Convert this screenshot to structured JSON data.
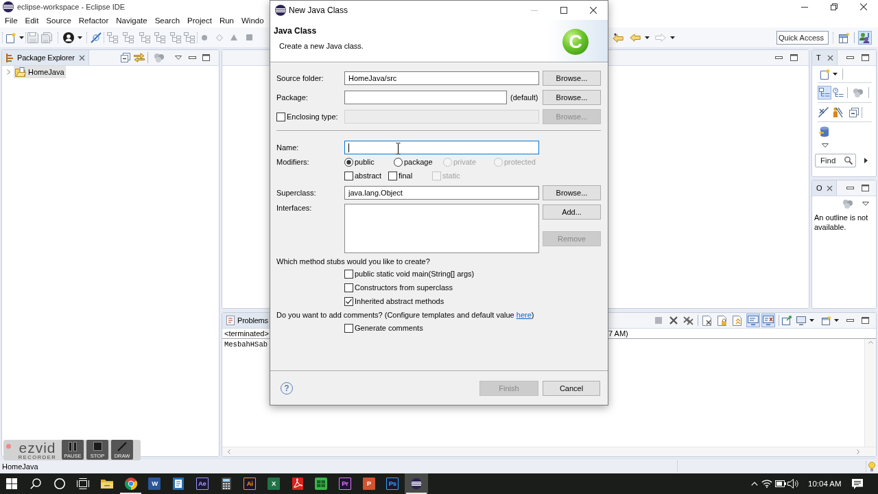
{
  "window": {
    "title": "eclipse-workspace - Eclipse IDE"
  },
  "menu": [
    "File",
    "Edit",
    "Source",
    "Refactor",
    "Navigate",
    "Search",
    "Project",
    "Run",
    "Windo"
  ],
  "toolbar": {
    "quick_access": {
      "placeholder": "Quick Access"
    },
    "perspective_button": {
      "selected": true
    }
  },
  "package_explorer": {
    "tab": "Package Explorer",
    "tree": [
      {
        "label": "HomeJava",
        "selected": true,
        "expanded": false
      }
    ]
  },
  "task_list": {
    "tab": "T",
    "toggles": [
      {
        "selected": true
      },
      {
        "selected": false
      }
    ],
    "find": {
      "placeholder": "Find"
    }
  },
  "outline": {
    "tab": "O",
    "message": "An outline is not available."
  },
  "console": {
    "tab": "Problems",
    "toolbar_toggles": [
      {
        "selected": true
      },
      {
        "selected": true
      }
    ],
    "launch_line": [
      "<terminated>",
      "7 AM)"
    ],
    "output": [
      "MesbahHSab"
    ]
  },
  "status_bar": {
    "text": "HomeJava"
  },
  "recorder": {
    "logo": "ezvid",
    "subtitle": "RECORDER",
    "buttons": [
      {
        "kind": "pause",
        "label": "PAUSE"
      },
      {
        "kind": "stop",
        "label": "STOP"
      },
      {
        "kind": "draw",
        "label": "DRAW"
      }
    ]
  },
  "dialog": {
    "title": "New Java Class",
    "window_buttons": [
      {
        "kind": "minimize",
        "disabled": true
      },
      {
        "kind": "maximize",
        "disabled": false
      },
      {
        "kind": "close",
        "disabled": false
      }
    ],
    "heading": "Java Class",
    "description": "Create a new Java class.",
    "badge": "C",
    "rows": [
      {
        "kind": "text",
        "label": "Source folder:",
        "value": "HomeJava/src",
        "disabled": false,
        "button": {
          "label": "Browse...",
          "disabled": false
        }
      },
      {
        "kind": "text",
        "label": "Package:",
        "suffix": "(default)",
        "disabled": false,
        "button": {
          "label": "Browse...",
          "disabled": false
        }
      },
      {
        "kind": "check",
        "label": "Enclosing type:",
        "checked": false,
        "disabled": true,
        "button": {
          "label": "Browse...",
          "disabled": true
        }
      }
    ],
    "name": {
      "label": "Name:",
      "focused": true
    },
    "modifiers": {
      "label": "Modifiers:",
      "access": [
        {
          "label": "public",
          "selected": true,
          "disabled": false
        },
        {
          "label": "package",
          "selected": false,
          "disabled": false
        },
        {
          "label": "private",
          "selected": false,
          "disabled": true
        },
        {
          "label": "protected",
          "selected": false,
          "disabled": true
        }
      ],
      "flags": [
        {
          "label": "abstract",
          "checked": false,
          "disabled": false
        },
        {
          "label": "final",
          "checked": false,
          "disabled": false
        },
        {
          "label": "static",
          "checked": false,
          "disabled": true
        }
      ]
    },
    "superclass": {
      "label": "Superclass:",
      "value": "java.lang.Object",
      "button": {
        "label": "Browse...",
        "disabled": false
      }
    },
    "interfaces": {
      "label": "Interfaces:",
      "buttons": [
        {
          "label": "Add...",
          "disabled": false
        },
        {
          "label": "Remove",
          "disabled": true
        }
      ]
    },
    "stubs": {
      "question": "Which method stubs would you like to create?",
      "options": [
        {
          "label": "public static void main(String[] args)",
          "checked": false
        },
        {
          "label": "Constructors from superclass",
          "checked": false
        },
        {
          "label": "Inherited abstract methods",
          "checked": true
        }
      ]
    },
    "comments": {
      "question": "Do you want to add comments? (Configure templates and default value",
      "link": "here",
      "closing": ")",
      "options": [
        {
          "label": "Generate comments",
          "checked": false
        }
      ]
    },
    "help": "?",
    "buttons": [
      {
        "label": "Finish",
        "disabled": true
      },
      {
        "label": "Cancel",
        "disabled": false
      }
    ]
  },
  "taskbar": {
    "apps": [
      {
        "kind": "folder",
        "running": false,
        "selected": false
      },
      {
        "kind": "browser",
        "running": true,
        "selected": false
      },
      {
        "kind": "tile",
        "glyph": "W",
        "color": "#2b579a",
        "running": false,
        "selected": false
      },
      {
        "kind": "notes",
        "running": false,
        "selected": false
      },
      {
        "kind": "adobe",
        "glyph": "Ae",
        "color": "#9999ff",
        "running": false,
        "selected": false
      },
      {
        "kind": "calculator",
        "running": false,
        "selected": false
      },
      {
        "kind": "adobe",
        "glyph": "Ai",
        "color": "#ff9a00",
        "running": false,
        "selected": false
      },
      {
        "kind": "tile",
        "glyph": "X",
        "color": "#217346",
        "running": false,
        "selected": false
      },
      {
        "kind": "pdf",
        "running": false,
        "selected": false
      },
      {
        "kind": "media",
        "running": false,
        "selected": false
      },
      {
        "kind": "adobe",
        "glyph": "Pr",
        "color": "#ea77ff",
        "running": false,
        "selected": false
      },
      {
        "kind": "tile",
        "glyph": "P",
        "color": "#d35230",
        "running": false,
        "selected": false
      },
      {
        "kind": "adobe",
        "glyph": "Ps",
        "color": "#31a8ff",
        "running": false,
        "selected": false
      },
      {
        "kind": "eclipse",
        "running": true,
        "selected": true
      }
    ],
    "clock": "10:04 AM"
  }
}
